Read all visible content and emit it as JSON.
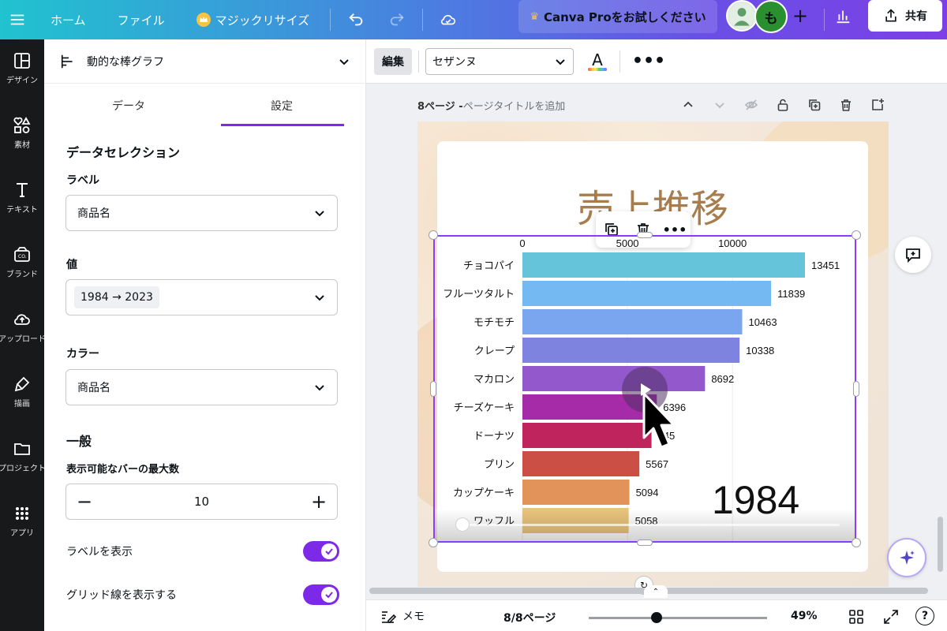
{
  "topbar": {
    "home": "ホーム",
    "file": "ファイル",
    "magic_resize": "マジックリサイズ",
    "pro_trial": "Canva Proをお試しください",
    "avatar_initial": "も",
    "share": "共有"
  },
  "rail": {
    "items": [
      "デザイン",
      "素材",
      "テキスト",
      "ブランド",
      "アップロード",
      "描画",
      "プロジェクト",
      "アプリ"
    ]
  },
  "panel": {
    "header_title": "動的な棒グラフ",
    "tabs": [
      "データ",
      "設定"
    ],
    "active_tab": "設定",
    "data_selection_title": "データセレクション",
    "label_field": {
      "label": "ラベル",
      "value": "商品名"
    },
    "value_field": {
      "label": "値",
      "value": "1984 → 2023"
    },
    "color_field": {
      "label": "カラー",
      "value": "商品名"
    },
    "general_title": "一般",
    "max_bars": {
      "label": "表示可能なバーの最大数",
      "value": "10",
      "minus": "−",
      "plus": "+"
    },
    "show_labels": {
      "label": "ラベルを表示",
      "on": true
    },
    "show_grid": {
      "label": "グリッド線を表示する",
      "on": true
    }
  },
  "context_toolbar": {
    "edit": "編集",
    "font": "セザンヌ",
    "color_letter": "A",
    "more": "•••"
  },
  "page_header": {
    "page_num": "8ページ - ",
    "page_title_placeholder": "ページタイトルを追加"
  },
  "design": {
    "title": "売上推移",
    "year": "1984"
  },
  "chart_data": {
    "type": "bar",
    "orientation": "horizontal",
    "x_ticks": [
      0,
      5000,
      10000
    ],
    "xlim": [
      0,
      13451
    ],
    "grid": true,
    "categories": [
      "チョコパイ",
      "フルーツタルト",
      "モチモチ",
      "クレープ",
      "マカロン",
      "チーズケーキ",
      "ドーナツ",
      "プリン",
      "カップケーキ",
      "ワッフル"
    ],
    "values": [
      13451,
      11839,
      10463,
      10338,
      8692,
      6396,
      6145,
      5567,
      5094,
      5058
    ],
    "value_labels": [
      "13451",
      "11839",
      "10463",
      "10338",
      "8692",
      "6396",
      "145",
      "5567",
      "5094",
      "5058"
    ],
    "colors": [
      "#66c4da",
      "#74b9f2",
      "#7aa6ef",
      "#7f83e0",
      "#9358cc",
      "#a52ba9",
      "#c0245c",
      "#cb4f45",
      "#e2935a",
      "#e8c47b"
    ]
  },
  "bottombar": {
    "memo": "メモ",
    "page_count": "8/8ページ",
    "zoom": "49%",
    "zoom_fraction": 0.49,
    "help": "?"
  }
}
